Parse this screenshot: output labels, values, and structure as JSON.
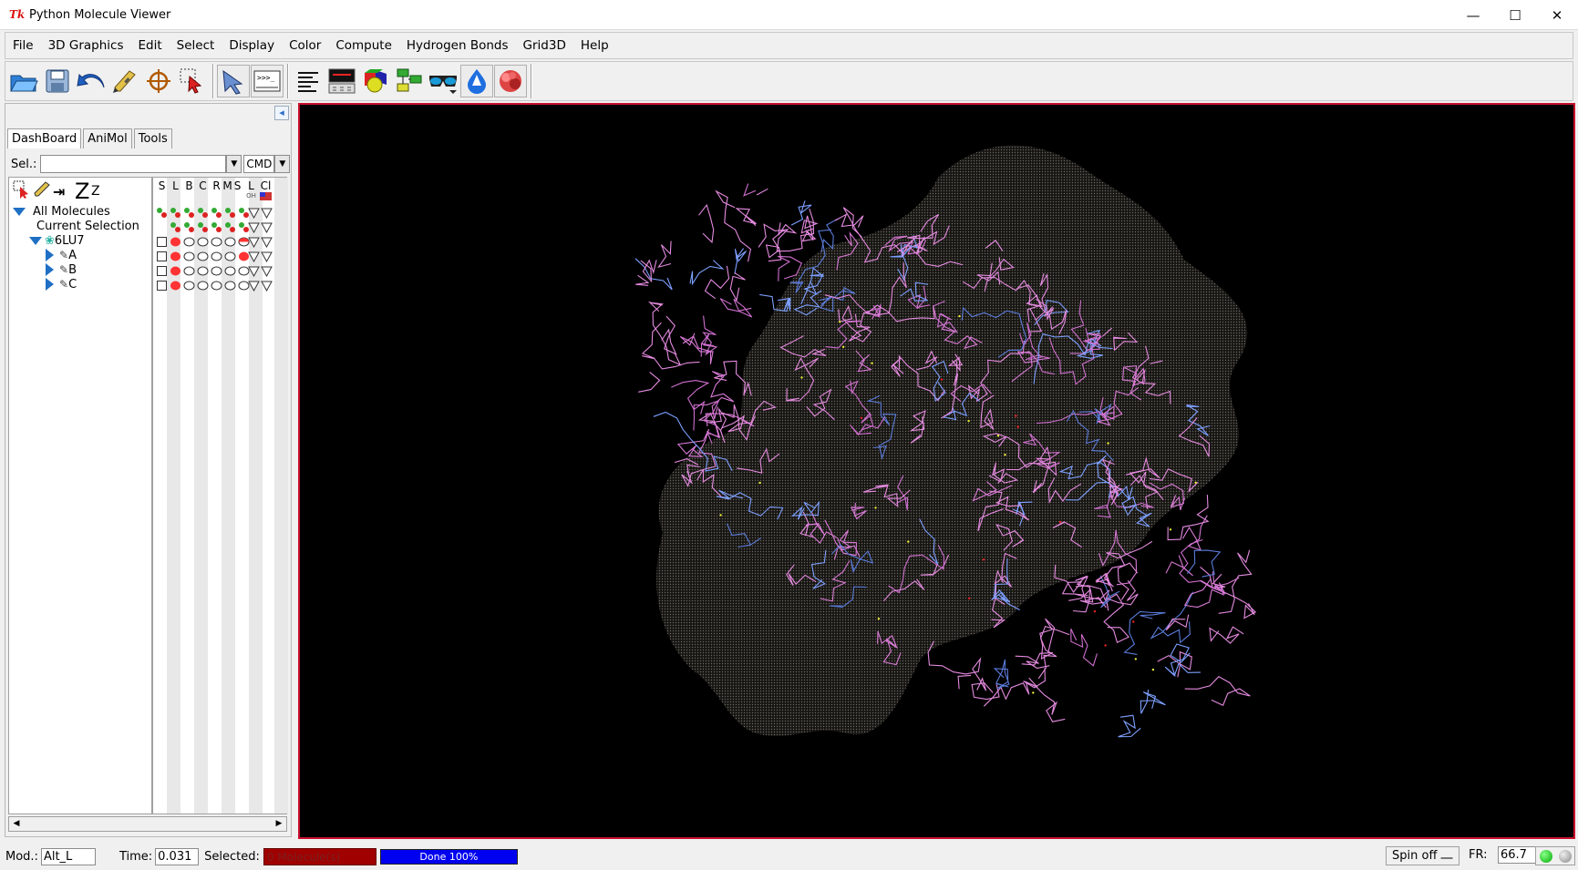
{
  "window": {
    "title": "Python Molecule Viewer",
    "logo_text": "Tk",
    "controls": [
      "—",
      "☐",
      "✕"
    ]
  },
  "menu": [
    "File",
    "3D Graphics",
    "Edit",
    "Select",
    "Display",
    "Color",
    "Compute",
    "Hydrogen Bonds",
    "Grid3D",
    "Help"
  ],
  "toolbar": {
    "icons": [
      "open-folder-icon",
      "save-icon",
      "undo-icon",
      "pencil-icon",
      "crosshair-icon",
      "select-icon",
      "pointer-icon",
      "python-shell-icon",
      "text-lines-icon",
      "monitor-icon",
      "shapes-icon",
      "pipeline-icon",
      "stereo-glasses-icon",
      "drop-icon",
      "surface-icon"
    ]
  },
  "sidebar": {
    "tabs": [
      "DashBoard",
      "AniMol",
      "Tools"
    ],
    "active_tab": "DashBoard",
    "sel_label": "Sel.:",
    "sel_value": "",
    "cmd_value": "CMD",
    "column_headers": [
      "S",
      "L",
      "B",
      "C",
      "R",
      "M",
      "S",
      "L",
      "Cl"
    ],
    "column_subs": [
      "",
      "",
      "",
      "",
      "",
      "",
      "",
      "OH",
      ""
    ],
    "tree": [
      {
        "label": "All Molecules",
        "level": 0,
        "expander": "down"
      },
      {
        "label": "Current Selection",
        "level": 1,
        "expander": "none"
      },
      {
        "label": "6LU7",
        "level": 1,
        "expander": "down"
      },
      {
        "label": "A",
        "level": 2,
        "expander": "right"
      },
      {
        "label": "B",
        "level": 2,
        "expander": "right"
      },
      {
        "label": "C",
        "level": 2,
        "expander": "right"
      }
    ],
    "zoom_glyph_big": "Z",
    "zoom_glyph_small": "Z"
  },
  "status": {
    "mod_label": "Mod.:",
    "mod_value": "Alt_L",
    "time_label": "Time:",
    "time_value": "0.031",
    "selected_label": "Selected:",
    "selected_value": "0 Molecule(s)",
    "progress_text": "Done 100%",
    "progress": 1.0,
    "spin_label": "Spin off",
    "fr_label": "FR:",
    "fr_value": "66.7"
  },
  "colors": {
    "viewer_bg": "#000000",
    "viewer_border": "#c8102e",
    "selected_bg": "#a00000",
    "progress_bg": "#0000f0"
  }
}
